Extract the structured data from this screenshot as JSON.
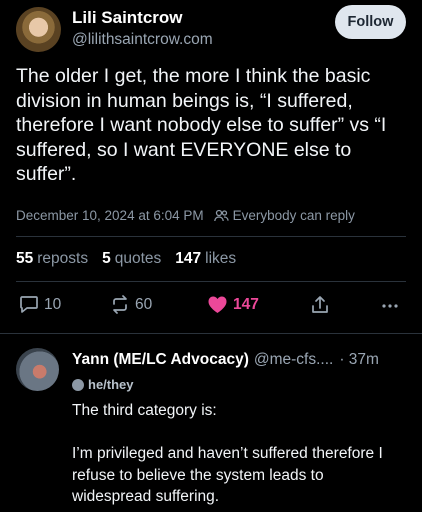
{
  "post": {
    "author_name": "Lili Saintcrow",
    "author_handle": "@lilithsaintcrow.com",
    "follow_label": "Follow",
    "text": "The older I get, the more I think the basic division in human beings is, “I suffered, therefore I want nobody else to suffer” vs “I suffered, so I want EVERYONE else to suffer”.",
    "timestamp": "December 10, 2024 at 6:04 PM",
    "reply_setting": "Everybody can reply",
    "reposts_count": "55",
    "reposts_label": "reposts",
    "quotes_count": "5",
    "quotes_label": "quotes",
    "likes_count": "147",
    "likes_label": "likes",
    "actions": {
      "replies": "10",
      "reposts": "60",
      "likes": "147"
    },
    "like_color": "#ec4899"
  },
  "reply": {
    "author_name": "Yann (ME/LC Advocacy)",
    "author_handle": "@me-cfs....",
    "time": "· 37m",
    "pronouns": "he/they",
    "text": "The third category is:\n\nI’m privileged and haven’t suffered therefore I refuse to believe the system leads to widespread suffering."
  },
  "icons": [
    "reply-icon",
    "repost-icon",
    "heart-icon",
    "share-icon",
    "more-icon",
    "people-icon"
  ]
}
